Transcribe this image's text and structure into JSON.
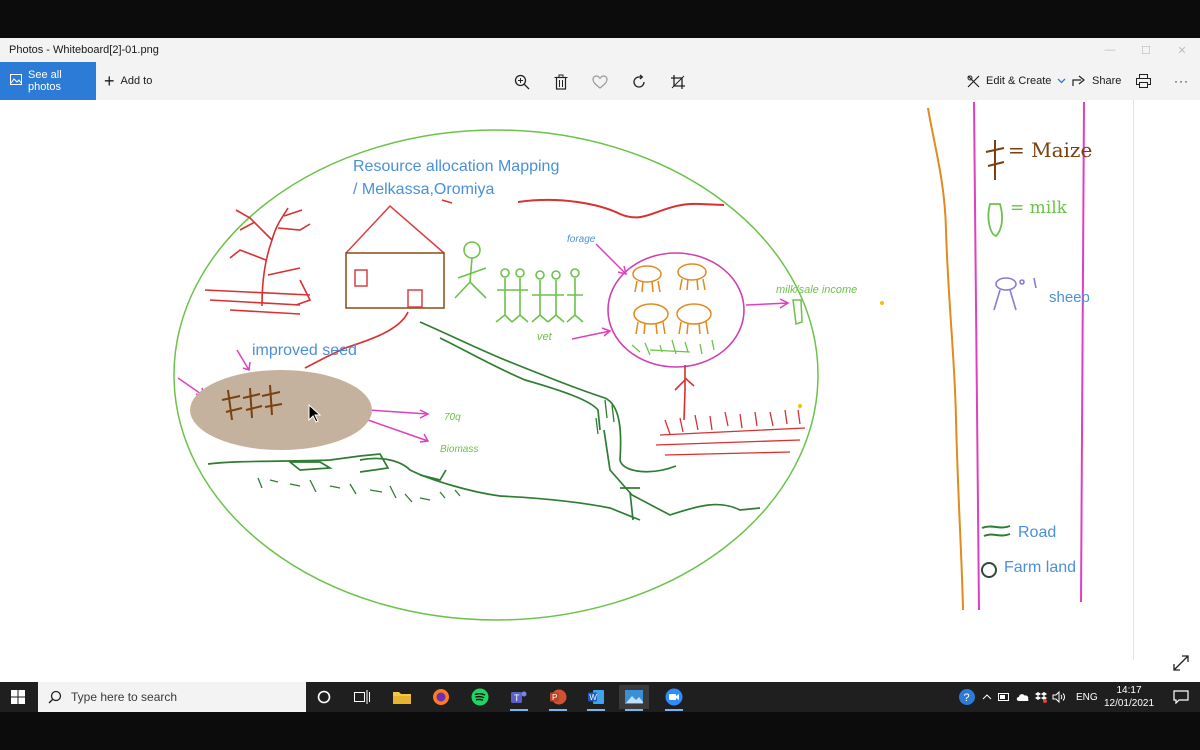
{
  "window": {
    "title": "Photos - Whiteboard[2]-01.png"
  },
  "toolbar": {
    "see_all_photos": "See all photos",
    "add_to": "Add to",
    "edit_create": "Edit & Create",
    "share": "Share",
    "more": "···"
  },
  "whiteboard": {
    "title_line1": "Resource allocation Mapping",
    "title_line2": "/ Melkassa,Oromiya",
    "improved_seed": "improved seed",
    "forage": "forage",
    "vet": "vet",
    "milk_sale_income": "milk/sale income",
    "yield_70q": "70q",
    "biomass": "Biomass",
    "legend_maize": "= Maize",
    "legend_milk": "= milk",
    "legend_sheep": "sheep",
    "legend_road": "Road",
    "legend_farmland": "Farm land"
  },
  "taskbar": {
    "search_placeholder": "Type here to search",
    "language": "ENG",
    "time": "14:17",
    "date": "12/01/2021"
  },
  "colors": {
    "accent": "#2b7bd7",
    "ink_blue": "#4a90d9",
    "ink_green": "#6cc24a",
    "ink_red": "#e04040",
    "ink_magenta": "#e040c0",
    "ink_orange": "#e08a20",
    "ink_brown": "#7a4010",
    "ink_darkgreen": "#2e7d32"
  }
}
